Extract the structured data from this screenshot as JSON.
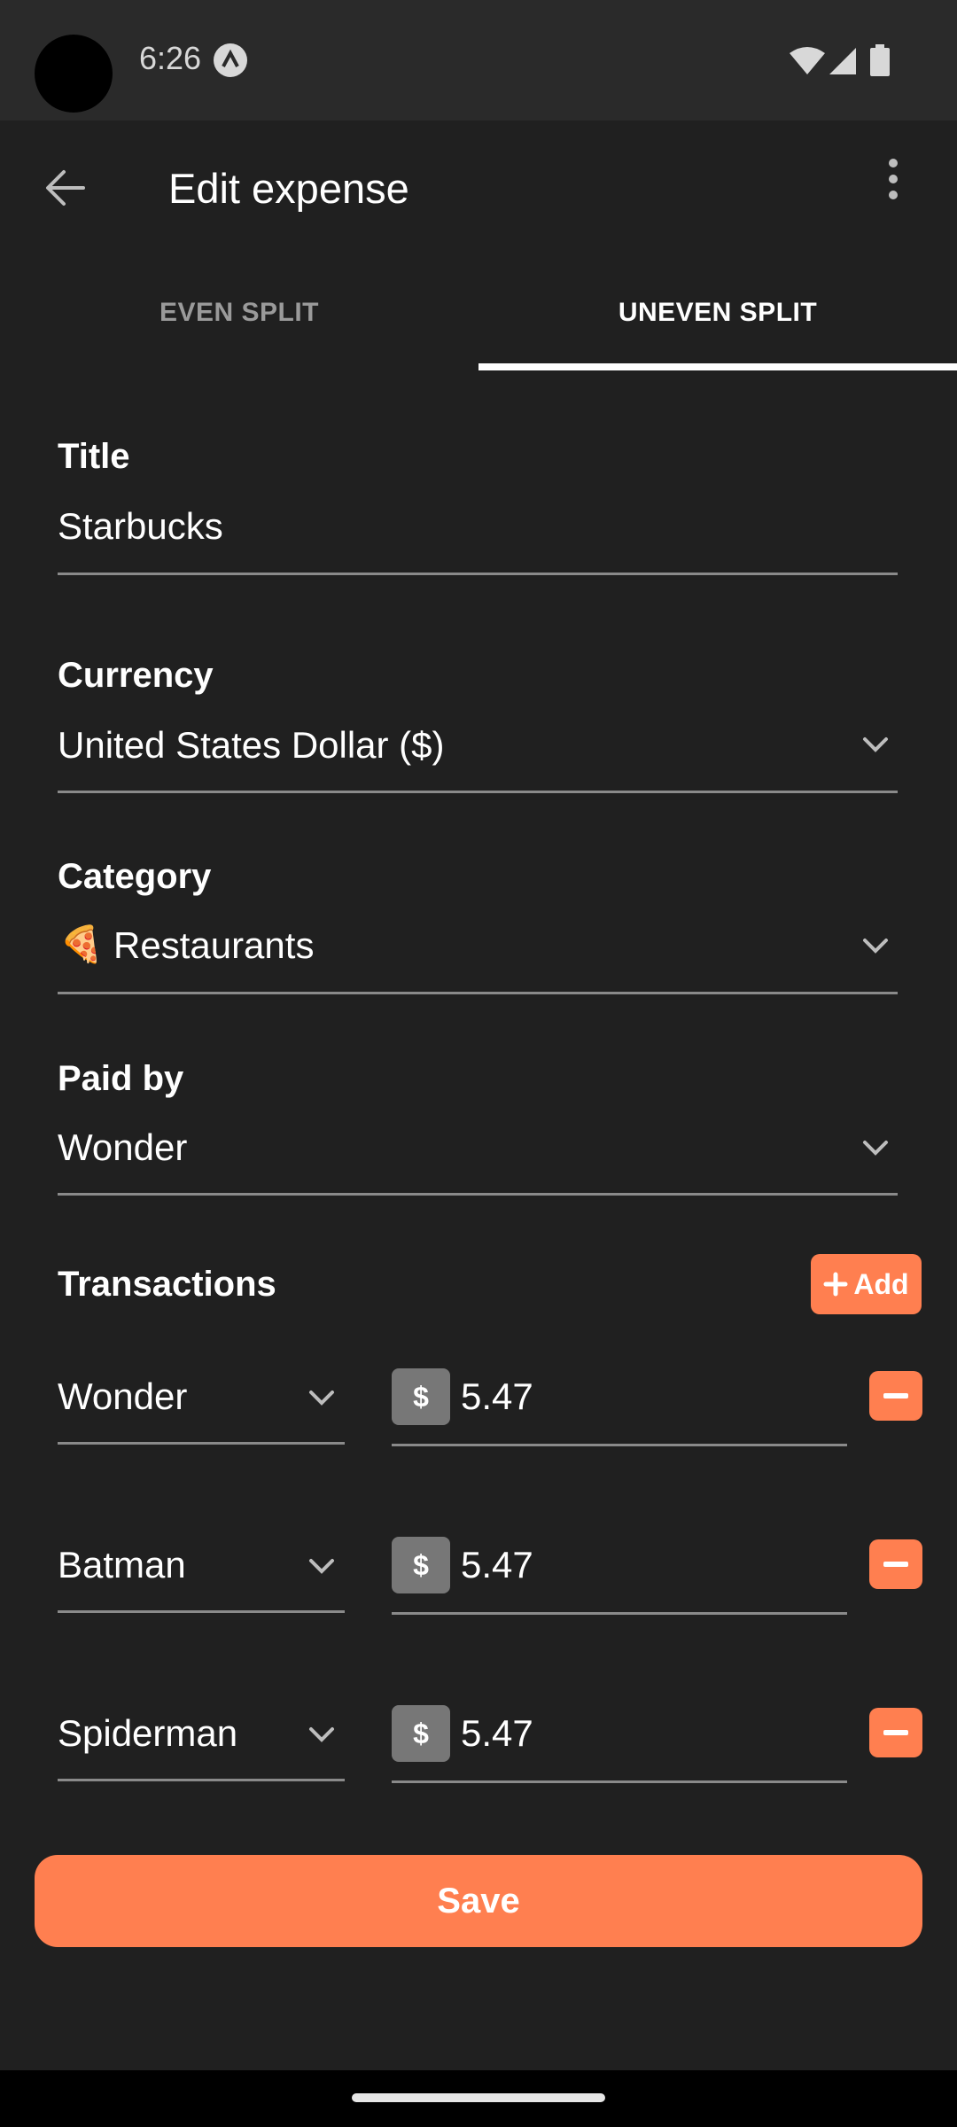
{
  "status_bar": {
    "time": "6:26"
  },
  "app_bar": {
    "title": "Edit expense"
  },
  "tabs": [
    {
      "label": "EVEN SPLIT",
      "selected": false
    },
    {
      "label": "UNEVEN SPLIT",
      "selected": true
    }
  ],
  "form": {
    "title": {
      "label": "Title",
      "value": "Starbucks"
    },
    "currency": {
      "label": "Currency",
      "value": "United States Dollar ($)"
    },
    "category": {
      "label": "Category",
      "emoji": "🍕",
      "value": "Restaurants"
    },
    "paid_by": {
      "label": "Paid by",
      "value": "Wonder"
    }
  },
  "transactions": {
    "label": "Transactions",
    "add_label": "Add",
    "items": [
      {
        "person": "Wonder",
        "currency_symbol": "$",
        "amount": "5.47"
      },
      {
        "person": "Batman",
        "currency_symbol": "$",
        "amount": "5.47"
      },
      {
        "person": "Spiderman",
        "currency_symbol": "$",
        "amount": "5.47"
      }
    ]
  },
  "save_label": "Save",
  "colors": {
    "accent": "#ff7f50",
    "background": "#202020"
  }
}
